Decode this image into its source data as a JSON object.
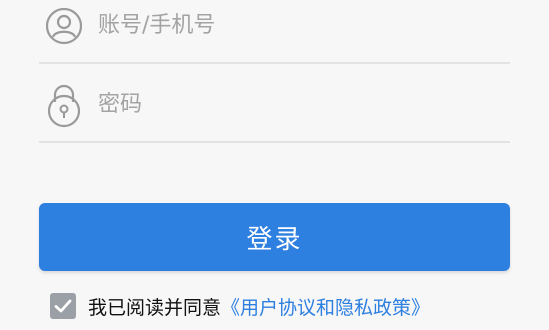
{
  "login": {
    "account_placeholder": "账号/手机号",
    "password_placeholder": "密码",
    "submit_label": "登录"
  },
  "agreement": {
    "checked": true,
    "text": "我已阅读并同意",
    "link_text": "《用户协议和隐私政策》"
  },
  "icons": {
    "account": "user-icon",
    "password": "lock-icon",
    "checkbox": "check-icon"
  },
  "colors": {
    "accent": "#2d7fe0",
    "icon_gray": "#9a9a9a",
    "placeholder": "#a3a3a3",
    "checkbox_bg": "#9aa0a6"
  }
}
